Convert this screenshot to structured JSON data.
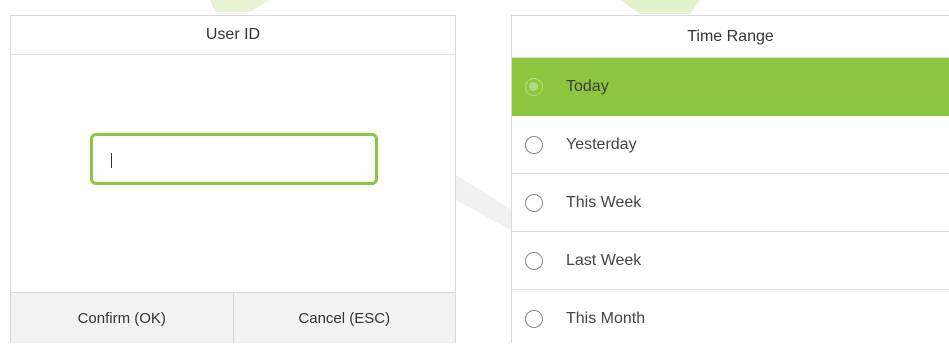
{
  "user_id_dialog": {
    "title": "User ID",
    "input_value": "",
    "confirm_label": "Confirm (OK)",
    "cancel_label": "Cancel (ESC)"
  },
  "time_range": {
    "title": "Time Range",
    "selected": "Today",
    "options": [
      {
        "label": "Today"
      },
      {
        "label": "Yesterday"
      },
      {
        "label": "This Week"
      },
      {
        "label": "Last Week"
      },
      {
        "label": "This Month"
      }
    ]
  },
  "colors": {
    "accent": "#8cc63f",
    "border": "#d9d9d9",
    "footer_bg": "#f2f2f2",
    "text": "#333333"
  }
}
